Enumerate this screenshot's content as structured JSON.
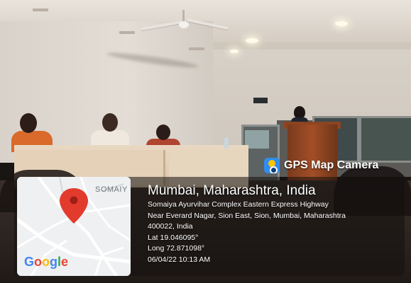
{
  "overlay": {
    "app_name": "GPS Map Camera",
    "location_title": "Mumbai, Maharashtra, India",
    "address_line1": "Somaiya Ayurvihar Complex Eastern Express Highway",
    "address_line2": "Near Everard Nagar, Sion East, Sion, Mumbai, Maharashtra",
    "address_line3": "400022, India",
    "latitude": "Lat 19.046095°",
    "longitude": "Long 72.871098°",
    "datetime": "06/04/22 10:13 AM"
  },
  "map": {
    "place_label": "SOMAIY",
    "logo_text": {
      "g1": "G",
      "g2": "o",
      "g3": "o",
      "g4": "g",
      "g5": "l",
      "g6": "e"
    },
    "pin_color": "#e23b2e",
    "icon": "location-pin-icon"
  },
  "colors": {
    "app_icon_bg": "#2f8df1",
    "overlay_text": "#ffffff"
  }
}
